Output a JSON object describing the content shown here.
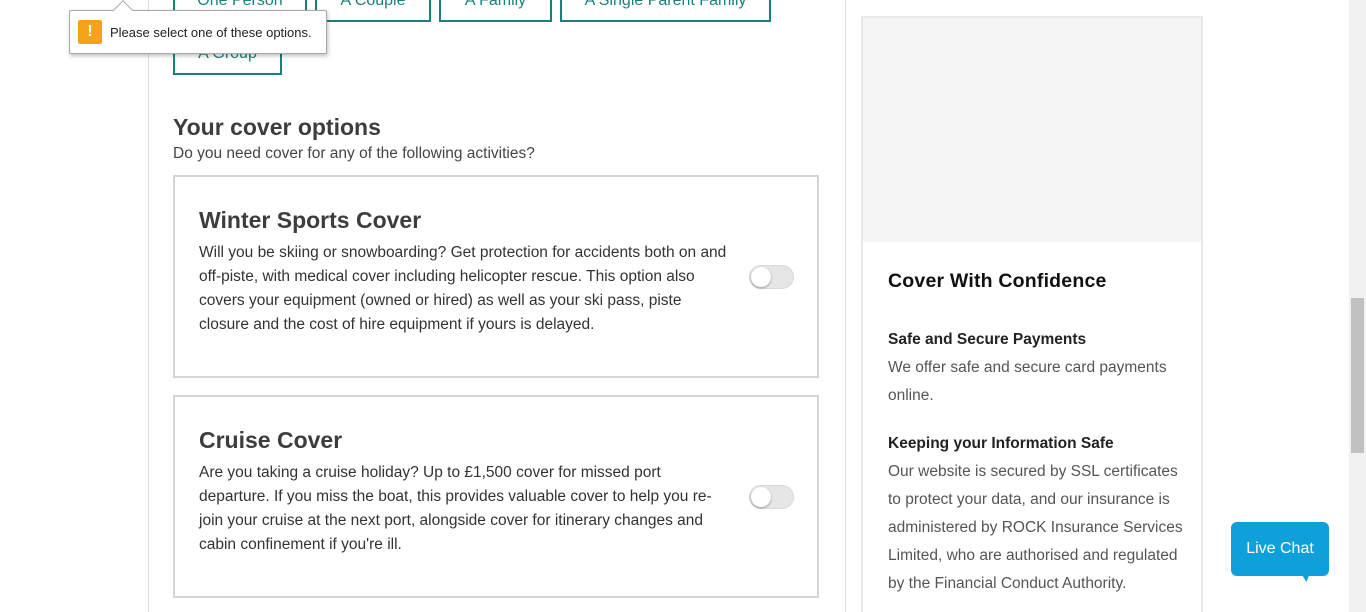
{
  "party": {
    "options": [
      "One Person",
      "A Couple",
      "A Family",
      "A Single Parent Family",
      "A Group"
    ],
    "validation_message": "Please select one of these options."
  },
  "cover": {
    "title": "Your cover options",
    "subtitle": "Do you need cover for any of the following activities?",
    "items": [
      {
        "title": "Winter Sports Cover",
        "description": "Will you be skiing or snowboarding? Get protection for accidents both on and off-piste, with medical cover including helicopter rescue. This option also covers your equipment (owned or hired) as well as your ski pass, piste closure and the cost of hire equipment if yours is delayed.",
        "selected": false
      },
      {
        "title": "Cruise Cover",
        "description": "Are you taking a cruise holiday? Up to £1,500 cover for missed port departure. If you miss the boat, this provides valuable cover to help you re-join your cruise at the next port, alongside cover for itinerary changes and cabin confinement if you're ill.",
        "selected": false
      }
    ]
  },
  "sidebar": {
    "title": "Cover With Confidence",
    "blocks": [
      {
        "heading": "Safe and Secure Payments",
        "text": "We offer safe and secure card payments online."
      },
      {
        "heading": "Keeping your Information Safe",
        "text": "Our website is secured by SSL certificates to protect your data, and our insurance is administered by ROCK Insurance Services Limited, who are authorised and regulated by the Financial Conduct Authority."
      }
    ]
  },
  "chat": {
    "label": "Live Chat"
  },
  "colors": {
    "brand_teal": "#1b7f7d",
    "chat_blue": "#0fa0dc",
    "warning": "#f5a31a"
  }
}
